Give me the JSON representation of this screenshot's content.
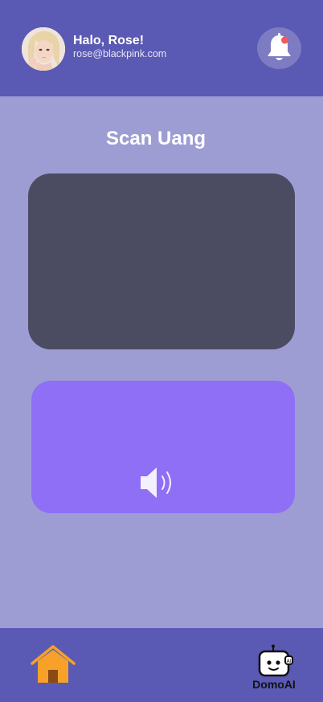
{
  "header": {
    "greeting": "Halo, Rose!",
    "email": "rose@blackpink.com",
    "avatar_icon": "user-photo",
    "notification_icon": "bell-icon",
    "notification_dot_color": "#f05a5a"
  },
  "main": {
    "title": "Scan Uang",
    "camera_preview_color": "#4b4b62",
    "result_card_color": "#8e6ff5",
    "speaker_icon": "speaker-icon"
  },
  "bottom_nav": {
    "home_icon": "home-icon",
    "home_color": "#f7a12b",
    "domo_label": "DomoAI",
    "domo_icon": "robot-icon"
  }
}
